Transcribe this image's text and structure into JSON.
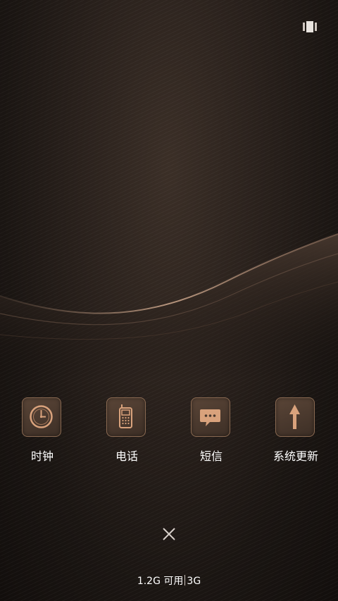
{
  "top_bar": {
    "multiwindow_icon": "multiwindow-icon"
  },
  "apps": [
    {
      "label": "时钟",
      "icon": "clock-icon"
    },
    {
      "label": "电话",
      "icon": "phone-icon"
    },
    {
      "label": "短信",
      "icon": "message-icon"
    },
    {
      "label": "系统更新",
      "icon": "update-arrow-icon"
    }
  ],
  "close": {
    "icon": "close-icon"
  },
  "status": {
    "memory_available": "1.2G 可用",
    "memory_total": "3G"
  },
  "colors": {
    "tile_border": "#8a6a52",
    "tile_fill": "#4a392e",
    "icon_accent": "#d9a27c",
    "text": "#ffffff"
  }
}
